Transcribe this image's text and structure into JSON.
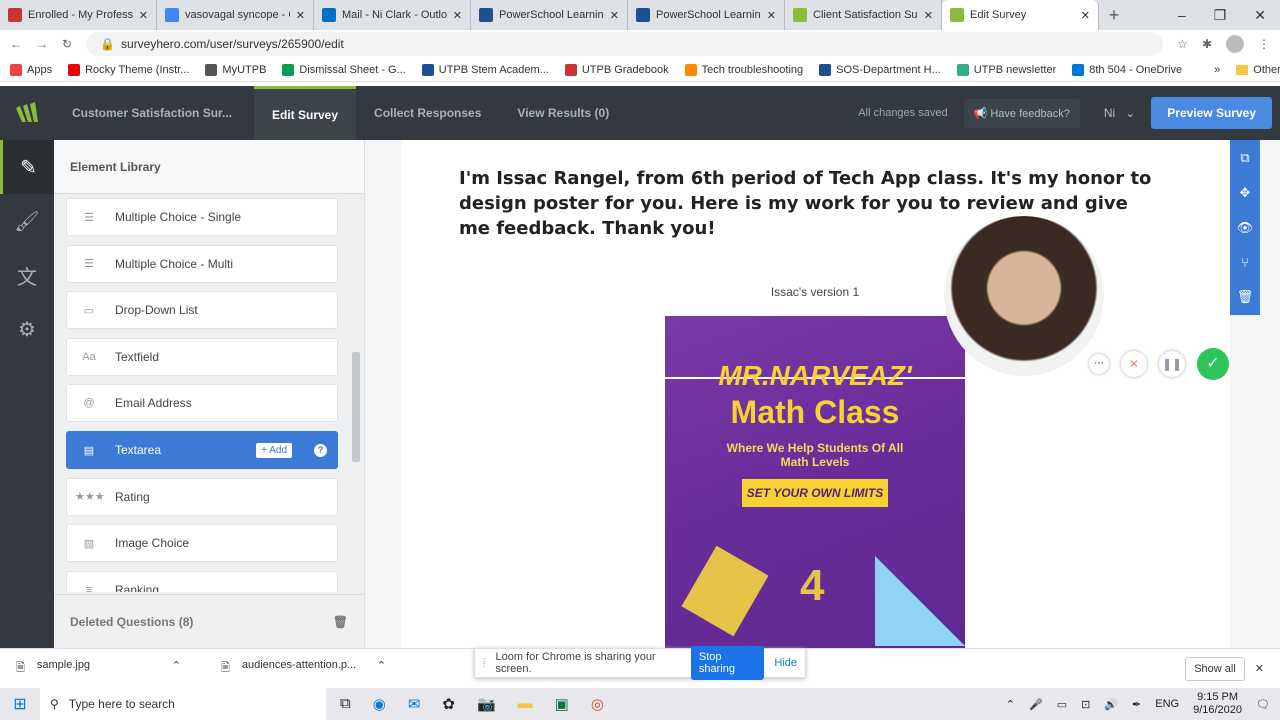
{
  "browser": {
    "tabs": [
      {
        "title": "Enrolled - My Professio",
        "color": "#c33"
      },
      {
        "title": "vasovagal syncope - Go",
        "color": "#4285f4"
      },
      {
        "title": "Mail - Ni Clark - Outlo",
        "color": "#0072c6"
      },
      {
        "title": "PowerSchool Learning",
        "color": "#1d4f91"
      },
      {
        "title": "PowerSchool Learning",
        "color": "#1d4f91"
      },
      {
        "title": "Client Satisfaction Surv",
        "color": "#8cbb3c"
      },
      {
        "title": "Edit Survey",
        "color": "#8cbb3c"
      }
    ],
    "url": "surveyhero.com/user/surveys/265900/edit",
    "bookmarks": [
      "Apps",
      "Rocky Theme (Instr...",
      "MyUTPB",
      "Dismissal Sheet - G...",
      "UTPB Stem Academ...",
      "UTPB Gradebook",
      "Tech troubleshooting",
      "SOS-Department H...",
      "UTPB newsletter",
      "8th 504 - OneDrive"
    ],
    "other_bookmarks": "Other bookmarks"
  },
  "app": {
    "survey_name": "Customer Satisfaction Sur...",
    "nav": [
      "Edit Survey",
      "Collect Responses",
      "View Results (0)"
    ],
    "status": "All changes saved",
    "feedback": "Have feedback?",
    "user": "Ni",
    "preview": "Preview Survey",
    "accent": "#8cbb3c",
    "primary": "#3b7bd5"
  },
  "library": {
    "title": "Element Library",
    "items": [
      {
        "label": "Multiple Choice - Single",
        "icon": "list-icon"
      },
      {
        "label": "Multiple Choice - Multi",
        "icon": "list-icon"
      },
      {
        "label": "Drop-Down List",
        "icon": "dropdown-icon"
      },
      {
        "label": "Textfield",
        "icon": "textfield-icon"
      },
      {
        "label": "Email Address",
        "icon": "at-icon"
      },
      {
        "label": "Textarea",
        "icon": "textarea-icon",
        "selected": true
      },
      {
        "label": "Rating",
        "icon": "stars-icon"
      },
      {
        "label": "Image Choice",
        "icon": "image-icon"
      },
      {
        "label": "Ranking",
        "icon": "ranking-icon"
      }
    ],
    "add_label": "+ Add",
    "help": "?",
    "deleted": "Deleted Questions (8)"
  },
  "content": {
    "intro": "I'm Issac Rangel, from 6th period of Tech App class.  It's my honor to design poster for you. Here is my work for you to review and give me feedback. Thank you!",
    "caption": "Issac's version 1",
    "poster": {
      "title1": "MR.NARVEAZ'",
      "title2": "Math Class",
      "subtitle": "Where We Help Students Of All Math Levels",
      "banner": "SET YOUR OWN LIMITS"
    }
  },
  "loom": {
    "message": "Loom for Chrome is sharing your screen.",
    "stop": "Stop sharing",
    "hide": "Hide"
  },
  "downloads": {
    "files": [
      "sample.jpg",
      "audiences-attention.p..."
    ],
    "show_all": "Show all"
  },
  "taskbar": {
    "search": "Type here to search",
    "lang": "ENG",
    "time": "9:15 PM",
    "date": "9/16/2020"
  }
}
